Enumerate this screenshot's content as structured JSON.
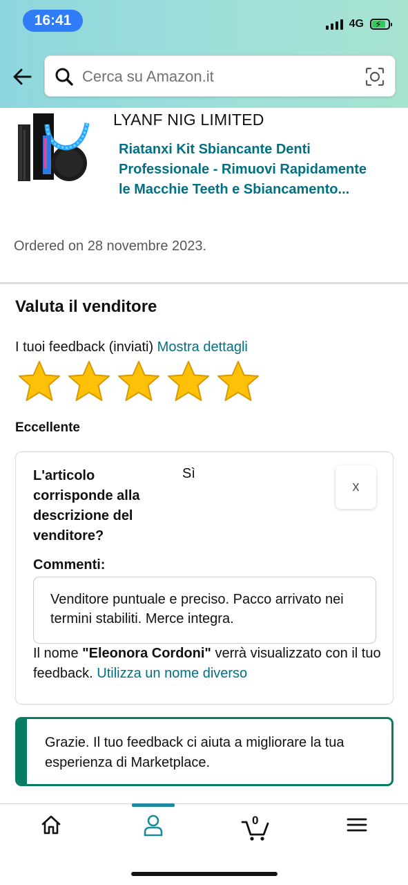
{
  "status_bar": {
    "time": "16:41",
    "network": "4G"
  },
  "search": {
    "placeholder": "Cerca su Amazon.it"
  },
  "product": {
    "seller": "LYANF NIG LIMITED",
    "title": "Riatanxi Kit Sbiancante Denti Professionale - Rimuovi Rapidamente le Macchie Teeth e Sbiancamento...",
    "ordered": "Ordered on 28 novembre 2023."
  },
  "rating": {
    "section_title": "Valuta il venditore",
    "feedback_label": "I tuoi feedback (inviati)",
    "details_link": "Mostra dettagli",
    "stars": 5,
    "max_stars": 5,
    "rating_text": "Eccellente"
  },
  "feedback_card": {
    "question": "L'articolo corrisponde alla descrizione del venditore?",
    "answer": "Sì",
    "close_label": "x",
    "comments_label": "Commenti:",
    "comment": "Venditore puntuale e preciso. Pacco arrivato nei termini stabiliti. Merce integra.",
    "name_prefix": "Il nome ",
    "name": "\"Eleonora Cordoni\"",
    "name_suffix": " verrà visualizzato con il tuo feedback. ",
    "change_name_link": "Utilizza un nome diverso"
  },
  "alert": {
    "text": "Grazie. Il tuo feedback ci aiuta a migliorare la tua esperienza di Marketplace."
  },
  "bottom_nav": {
    "cart_count": "0",
    "items": [
      "home-icon",
      "user-icon",
      "cart-icon",
      "menu-icon"
    ],
    "active_index": 1
  },
  "colors": {
    "link": "#007185",
    "success": "#067d62",
    "star": "#ffc107",
    "header_gradient": [
      "#8ed6de",
      "#a6e3d0"
    ]
  }
}
